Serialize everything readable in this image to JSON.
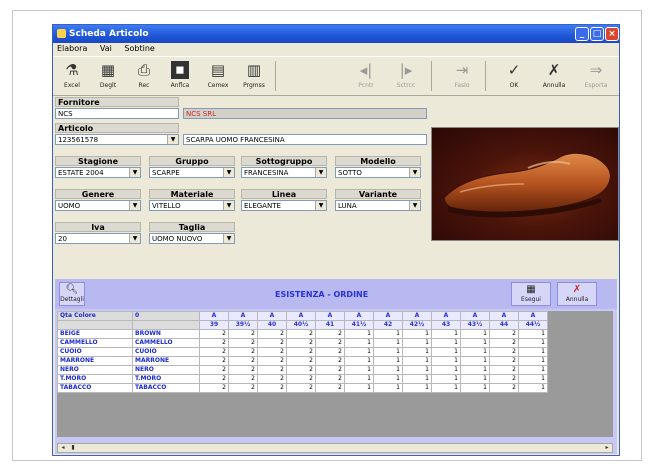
{
  "window": {
    "title": "Scheda Articolo"
  },
  "menu": [
    "Elabora",
    "Vai",
    "Sobtine"
  ],
  "toolbar": [
    {
      "label": "Excel",
      "icon": "excel-icon",
      "disabled": false
    },
    {
      "label": "Deglt",
      "icon": "folder-icon",
      "disabled": false
    },
    {
      "label": "Rec",
      "icon": "printer-icon",
      "disabled": false
    },
    {
      "label": "Anflca",
      "icon": "camera-icon",
      "disabled": false
    },
    {
      "label": "Cemex",
      "icon": "document-icon",
      "disabled": false
    },
    {
      "label": "Prgmss",
      "icon": "chart-icon",
      "disabled": false
    },
    {
      "label": "Pcntr",
      "icon": "prev-icon",
      "disabled": true
    },
    {
      "label": "Sctrcc",
      "icon": "next-icon",
      "disabled": true
    },
    {
      "label": "Faslo",
      "icon": "link-icon",
      "disabled": true
    },
    {
      "label": "OK",
      "icon": "ok-icon",
      "disabled": false
    },
    {
      "label": "Annulla",
      "icon": "cancel-icon",
      "disabled": false
    },
    {
      "label": "Esporta",
      "icon": "export-icon",
      "disabled": true
    }
  ],
  "fornitore": {
    "label": "Fornitore",
    "code": "NCS",
    "name": "NCS SRL"
  },
  "articolo": {
    "label": "Articolo",
    "code": "123561578",
    "desc": "SCARPA UOMO FRANCESINA"
  },
  "fields_row1": [
    {
      "label": "Stagione",
      "value": "ESTATE 2004"
    },
    {
      "label": "Gruppo",
      "value": "SCARPE"
    },
    {
      "label": "Sottogruppo",
      "value": "FRANCESINA"
    },
    {
      "label": "Modello",
      "value": "SOTTO"
    }
  ],
  "fields_row2": [
    {
      "label": "Genere",
      "value": "UOMO"
    },
    {
      "label": "Materiale",
      "value": "VITELLO"
    },
    {
      "label": "Linea",
      "value": "ELEGANTE"
    },
    {
      "label": "Variante",
      "value": "LUNA"
    }
  ],
  "fields_row3": [
    {
      "label": "Iva",
      "value": "20"
    },
    {
      "label": "Taglia",
      "value": "UOMO NUOVO"
    }
  ],
  "grid": {
    "title": "ESISTENZA - ORDINE",
    "left_button": "Dettagli",
    "right_buttons": [
      "Esegui",
      "Annulla"
    ],
    "col_header_1": "Qta Colore",
    "col_header_2": "0",
    "size_prefix": "A",
    "sizes": [
      "39",
      "39½",
      "40",
      "40½",
      "41",
      "41½",
      "42",
      "42½",
      "43",
      "43½",
      "44",
      "44½"
    ],
    "rows": [
      {
        "code": "BEIGE",
        "name": "BROWN",
        "q": [
          "2",
          "2",
          "2",
          "2",
          "2",
          "1",
          "1",
          "1",
          "1",
          "1",
          "2",
          "1"
        ]
      },
      {
        "code": "CAMMELLO",
        "name": "CAMMELLO",
        "q": [
          "2",
          "2",
          "2",
          "2",
          "2",
          "1",
          "1",
          "1",
          "1",
          "1",
          "2",
          "1"
        ]
      },
      {
        "code": "CUOIO",
        "name": "CUOIO",
        "q": [
          "2",
          "2",
          "2",
          "2",
          "2",
          "1",
          "1",
          "1",
          "1",
          "1",
          "2",
          "1"
        ]
      },
      {
        "code": "MARRONE",
        "name": "MARRONE",
        "q": [
          "2",
          "2",
          "2",
          "2",
          "2",
          "1",
          "1",
          "1",
          "1",
          "1",
          "2",
          "1"
        ]
      },
      {
        "code": "NERO",
        "name": "NERO",
        "q": [
          "2",
          "2",
          "2",
          "2",
          "2",
          "1",
          "1",
          "1",
          "1",
          "1",
          "2",
          "1"
        ]
      },
      {
        "code": "T.MORO",
        "name": "T.MORO",
        "q": [
          "2",
          "2",
          "2",
          "2",
          "2",
          "1",
          "1",
          "1",
          "1",
          "1",
          "2",
          "1"
        ]
      },
      {
        "code": "TABACCO",
        "name": "TABACCO",
        "q": [
          "2",
          "2",
          "2",
          "2",
          "2",
          "1",
          "1",
          "1",
          "1",
          "1",
          "2",
          "1"
        ]
      }
    ]
  },
  "colors": {
    "title_blue": "#1f56d8",
    "panel": "#c8c8f6",
    "accent_red": "#c62b2b",
    "grid_blue": "#1a2ad0"
  }
}
